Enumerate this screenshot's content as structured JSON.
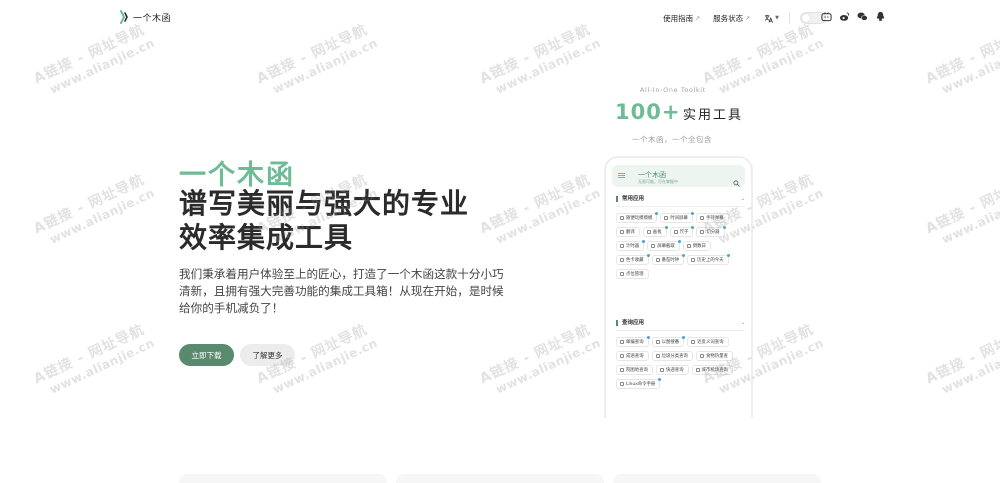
{
  "brand": {
    "name": "一个木函",
    "logo_icon": "wood-box-logo-icon",
    "accent_color": "#6dbc95"
  },
  "nav": {
    "links": [
      {
        "label": "使用指南",
        "icon": "external-link-icon"
      },
      {
        "label": "服务状态",
        "icon": "external-link-icon"
      }
    ],
    "language_icon": "translate-icon",
    "theme_toggle_icon": "theme-toggle-icon",
    "socials": [
      "bilibili-icon",
      "weibo-icon",
      "wechat-icon",
      "qq-icon"
    ]
  },
  "hero": {
    "accent": "一个木函",
    "title_line1": "谱写美丽与强大的专业",
    "title_line2": "效率集成工具",
    "description": "我们秉承着用户体验至上的匠心，打造了一个木函这款十分小巧清新，且拥有强大完善功能的集成工具箱！从现在开始，是时候给你的手机减负了！",
    "primary_button": "立即下载",
    "secondary_button": "了解更多",
    "primary_color": "#5a8a6e"
  },
  "promo": {
    "small": "All-In-One Toolkit",
    "count": "100+",
    "label": "实用工具",
    "sub": "一个木函，一个全包含"
  },
  "phone": {
    "title": "一个木函",
    "tagline": "无限可能，尽在掌握中",
    "sections": [
      {
        "title": "常用应用",
        "tags": [
          {
            "label": "随便玩摸摸模",
            "dot": true
          },
          {
            "label": "时间屏幕",
            "dot": true
          },
          {
            "label": "手持弹幕",
            "dot": false
          },
          {
            "label": "翻译",
            "dot": false
          },
          {
            "label": "画板",
            "dot": true
          },
          {
            "label": "尺子",
            "dot": true
          },
          {
            "label": "切分器",
            "dot": true
          },
          {
            "label": "计时器",
            "dot": true
          },
          {
            "label": "屏幕截取",
            "dot": true
          },
          {
            "label": "倒数日",
            "dot": false
          },
          {
            "label": "色卡收藏",
            "dot": true
          },
          {
            "label": "番茄时钟",
            "dot": true
          },
          {
            "label": "历史上的今天",
            "dot": true
          },
          {
            "label": "点位管理",
            "dot": false
          }
        ]
      },
      {
        "title": "查询应用",
        "tags": [
          {
            "label": "邮编查询",
            "dot": true
          },
          {
            "label": "以图搜番",
            "dot": true
          },
          {
            "label": "近反义词查询",
            "dot": false
          },
          {
            "label": "成语查询",
            "dot": false
          },
          {
            "label": "垃圾分类查询",
            "dot": false
          },
          {
            "label": "食物热量查",
            "dot": false
          },
          {
            "label": "院图地查询",
            "dot": false
          },
          {
            "label": "快递查询",
            "dot": false
          },
          {
            "label": "城市机场查询",
            "dot": false
          },
          {
            "label": "Linux命令手册",
            "dot": true
          }
        ]
      }
    ]
  },
  "watermark": {
    "line1": "A链接 - 网址导航",
    "line2": "www.alianjie.cn"
  }
}
